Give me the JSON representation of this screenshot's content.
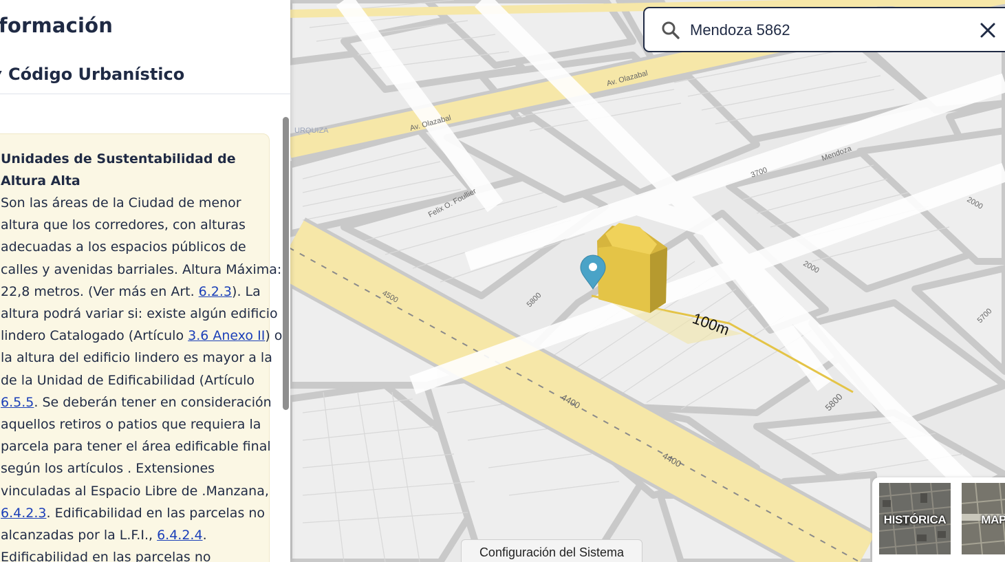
{
  "panel": {
    "title": "formación",
    "section_title": "Código Urbanístico",
    "card": {
      "heading": "Unidades de Sustentabilidad de Altura Alta",
      "lines": [
        [
          "Son las áreas de la Ciudad de menor"
        ],
        [
          "altura que los corredores, con alturas"
        ],
        [
          "adecuadas a los espacios públicos de"
        ],
        [
          "calles y avenidas barriales. Altura Máxima:"
        ],
        [
          "22,8 metros. (Ver más en Art. ",
          {
            "link": "6.2.3"
          },
          "). La"
        ],
        [
          "altura podrá variar si: existe algún edificio"
        ],
        [
          "lindero Catalogado (Artículo ",
          {
            "link": "3.6 Anexo II"
          },
          ") o"
        ],
        [
          "la altura del edificio lindero es mayor a la"
        ],
        [
          "de la Unidad de Edificabilidad (Artículo"
        ],
        [
          {
            "link": "6.5.5"
          },
          ". Se deberán tener en consideración"
        ],
        [
          "aquellos retiros o patios que requiera la"
        ],
        [
          "parcela para tener el área edificable final"
        ],
        [
          "según los artículos . Extensiones"
        ],
        [
          "vinculadas al Espacio Libre de .Manzana,"
        ],
        [
          {
            "link": "6.4.2.3"
          },
          ". Edificabilidad en las parcelas no"
        ],
        [
          "alcanzadas por la L.F.I., ",
          {
            "link": "6.4.2.4"
          },
          "."
        ],
        [
          "Edificabilidad en las parcelas no"
        ]
      ]
    }
  },
  "search": {
    "value": "Mendoza 5862",
    "icon": "search-icon",
    "clear_icon": "close-icon"
  },
  "map": {
    "street_labels": [
      "Av. Olazabal",
      "Av. Olazabal",
      "Felix O. Foullier",
      "Mendoza",
      "URQUIZA"
    ],
    "house_numbers": [
      "4500",
      "5800",
      "4400",
      "4400",
      "5800",
      "2000",
      "5700",
      "3700",
      "2000"
    ],
    "scale_label": "100m",
    "marker_color": "#4aa3c7",
    "building_color": "#e4c447"
  },
  "config_button": {
    "label": "Configuración del Sistema"
  },
  "layers": {
    "items": [
      {
        "label": "HISTÓRICA"
      },
      {
        "label": "MAPA"
      }
    ]
  }
}
